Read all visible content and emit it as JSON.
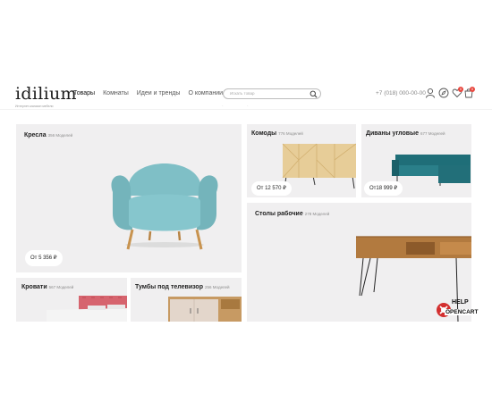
{
  "header": {
    "logo": "idilium",
    "tagline": "Интернет-магазин мебели",
    "nav": [
      "Товары",
      "Комнаты",
      "Идеи и тренды",
      "О компании"
    ],
    "search_placeholder": "Искать товар",
    "phone": "+7 (018) 000-00-00",
    "wishlist_count": "0",
    "cart_count": "0"
  },
  "tiles": {
    "armchairs": {
      "title": "Кресла",
      "count": "356 Моделей",
      "price": "От 5 356 ₽"
    },
    "dressers": {
      "title": "Комоды",
      "count": "776 Моделей",
      "price": "От 12 570 ₽"
    },
    "sofas": {
      "title": "Диваны угловые",
      "count": "677 Моделей",
      "price": "От18 999 ₽"
    },
    "desks": {
      "title": "Столы рабочие",
      "count": "278 Моделей"
    },
    "beds": {
      "title": "Кровати",
      "count": "567 Моделей"
    },
    "tv_stands": {
      "title": "Тумбы под телевизор",
      "count": "256 Моделей"
    }
  },
  "watermark": {
    "line1": "HELP",
    "line2": "OPENCART"
  },
  "colors": {
    "tile_bg": "#f0eff0",
    "accent": "#e8453c",
    "armchair": "#7fbfc6",
    "sofa": "#1f6e78"
  },
  "icons": [
    "search-icon",
    "user-icon",
    "compass-icon",
    "heart-icon",
    "cart-icon"
  ]
}
